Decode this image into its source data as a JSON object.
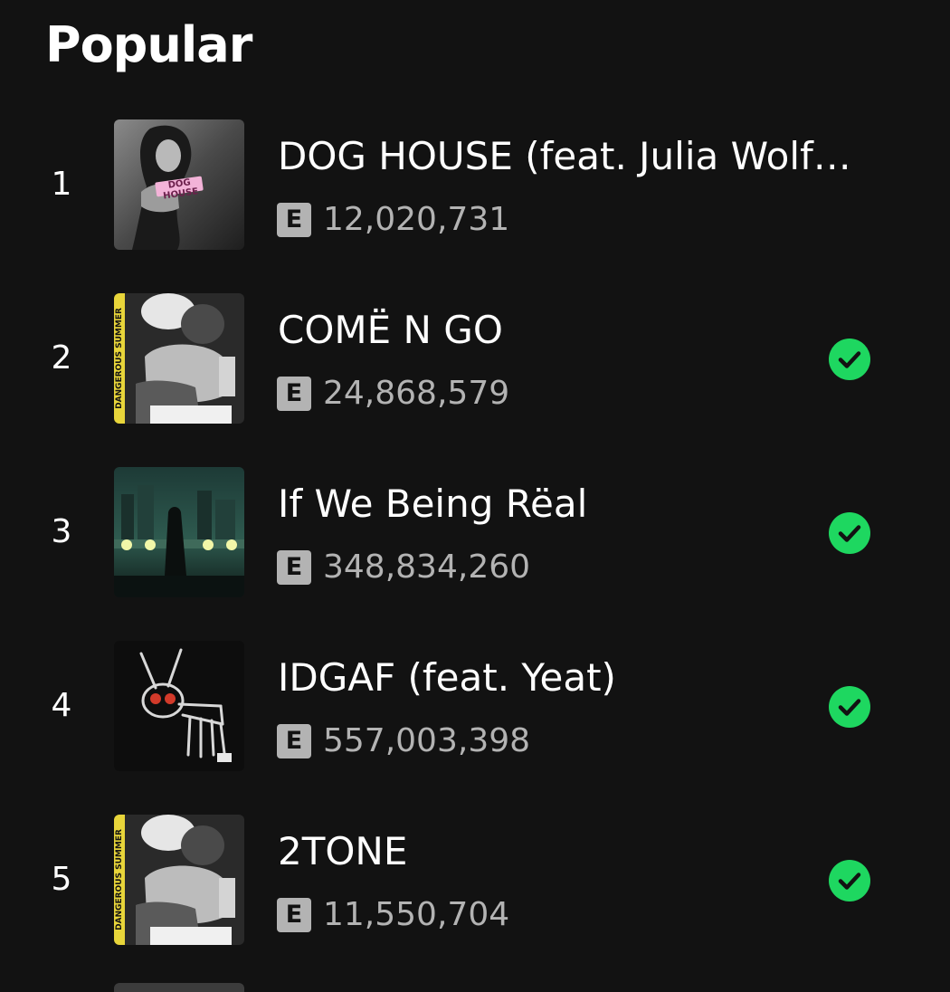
{
  "section": {
    "title": "Popular"
  },
  "tracks": [
    {
      "rank": "1",
      "title": "DOG HOUSE (feat. Julia Wolf…",
      "explicit_badge": "E",
      "plays": "12,020,731",
      "saved": false,
      "cover_icon": "dog-house-cover",
      "cover_text": "DOG HOUSE"
    },
    {
      "rank": "2",
      "title": "COMË N GO",
      "explicit_badge": "E",
      "plays": "24,868,579",
      "saved": true,
      "cover_icon": "dangerous-summer-cover",
      "cover_text": "DANGEROUS SUMMER"
    },
    {
      "rank": "3",
      "title": "If We Being Rëal",
      "explicit_badge": "E",
      "plays": "348,834,260",
      "saved": true,
      "cover_icon": "night-city-cover"
    },
    {
      "rank": "4",
      "title": "IDGAF (feat. Yeat)",
      "explicit_badge": "E",
      "plays": "557,003,398",
      "saved": true,
      "cover_icon": "drawn-dog-cover"
    },
    {
      "rank": "5",
      "title": "2TONE",
      "explicit_badge": "E",
      "plays": "11,550,704",
      "saved": true,
      "cover_icon": "dangerous-summer-cover",
      "cover_text": "DANGEROUS SUMMER"
    }
  ],
  "colors": {
    "background": "#121212",
    "text_primary": "#ffffff",
    "text_secondary": "#b3b3b3",
    "accent_saved": "#1ed760"
  }
}
